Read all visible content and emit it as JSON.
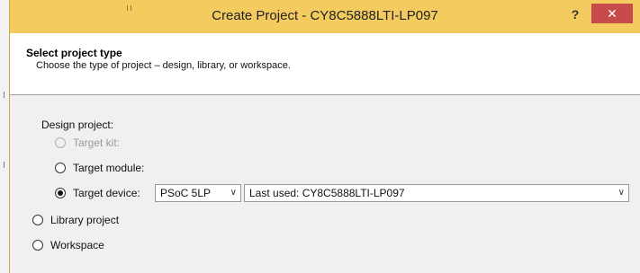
{
  "window": {
    "title": "Create Project - CY8C5888LTI-LP097",
    "help_label": "?",
    "close_label": "✕"
  },
  "header": {
    "title": "Select project type",
    "subtitle": "Choose the type of project – design, library, or workspace."
  },
  "design_project": {
    "label": "Design project:",
    "options": {
      "target_kit": {
        "label": "Target kit:",
        "enabled": false,
        "checked": false
      },
      "target_module": {
        "label": "Target module:",
        "enabled": true,
        "checked": false
      },
      "target_device": {
        "label": "Target device:",
        "enabled": true,
        "checked": true
      }
    },
    "family_select": {
      "value": "PSoC 5LP"
    },
    "device_select": {
      "value": "Last used: CY8C5888LTI-LP097"
    }
  },
  "library_project": {
    "label": "Library project",
    "checked": false
  },
  "workspace": {
    "label": "Workspace",
    "checked": false
  },
  "colors": {
    "titlebar": "#f4cb5e",
    "close_button": "#c74b4a",
    "dialog_background": "#f0f0f0"
  }
}
